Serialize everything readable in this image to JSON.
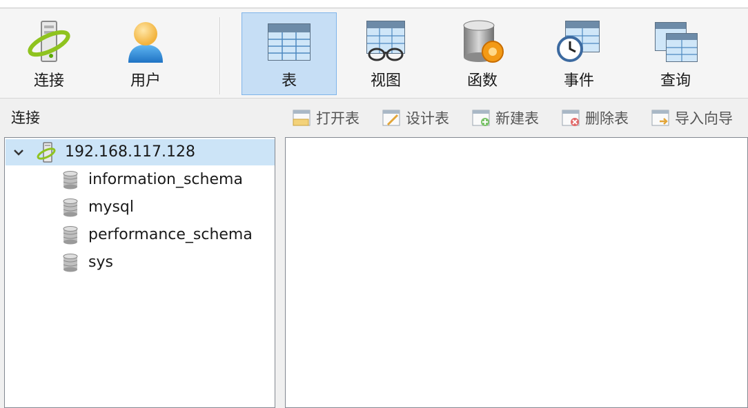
{
  "toolbar": {
    "buttons": [
      {
        "label": "连接",
        "icon": "connection-icon",
        "active": false
      },
      {
        "label": "用户",
        "icon": "user-icon",
        "active": false
      },
      {
        "label": "表",
        "icon": "table-icon",
        "active": true
      },
      {
        "label": "视图",
        "icon": "view-icon",
        "active": false
      },
      {
        "label": "函数",
        "icon": "function-icon",
        "active": false
      },
      {
        "label": "事件",
        "icon": "event-icon",
        "active": false
      },
      {
        "label": "查询",
        "icon": "query-icon",
        "active": false
      }
    ]
  },
  "section": {
    "title": "连接",
    "actions": [
      {
        "label": "打开表",
        "icon": "open-table-icon"
      },
      {
        "label": "设计表",
        "icon": "design-table-icon"
      },
      {
        "label": "新建表",
        "icon": "new-table-icon"
      },
      {
        "label": "删除表",
        "icon": "delete-table-icon"
      },
      {
        "label": "导入向导",
        "icon": "import-wizard-icon"
      }
    ]
  },
  "tree": {
    "server": {
      "label": "192.168.117.128",
      "expanded": true,
      "icon": "server-connection-icon"
    },
    "databases": [
      {
        "label": "information_schema",
        "icon": "database-icon"
      },
      {
        "label": "mysql",
        "icon": "database-icon"
      },
      {
        "label": "performance_schema",
        "icon": "database-icon"
      },
      {
        "label": "sys",
        "icon": "database-icon"
      }
    ]
  },
  "colors": {
    "active_tab_bg": "#c6def5",
    "active_tab_border": "#7eb4ea",
    "selected_row_bg": "#cce4f7"
  }
}
